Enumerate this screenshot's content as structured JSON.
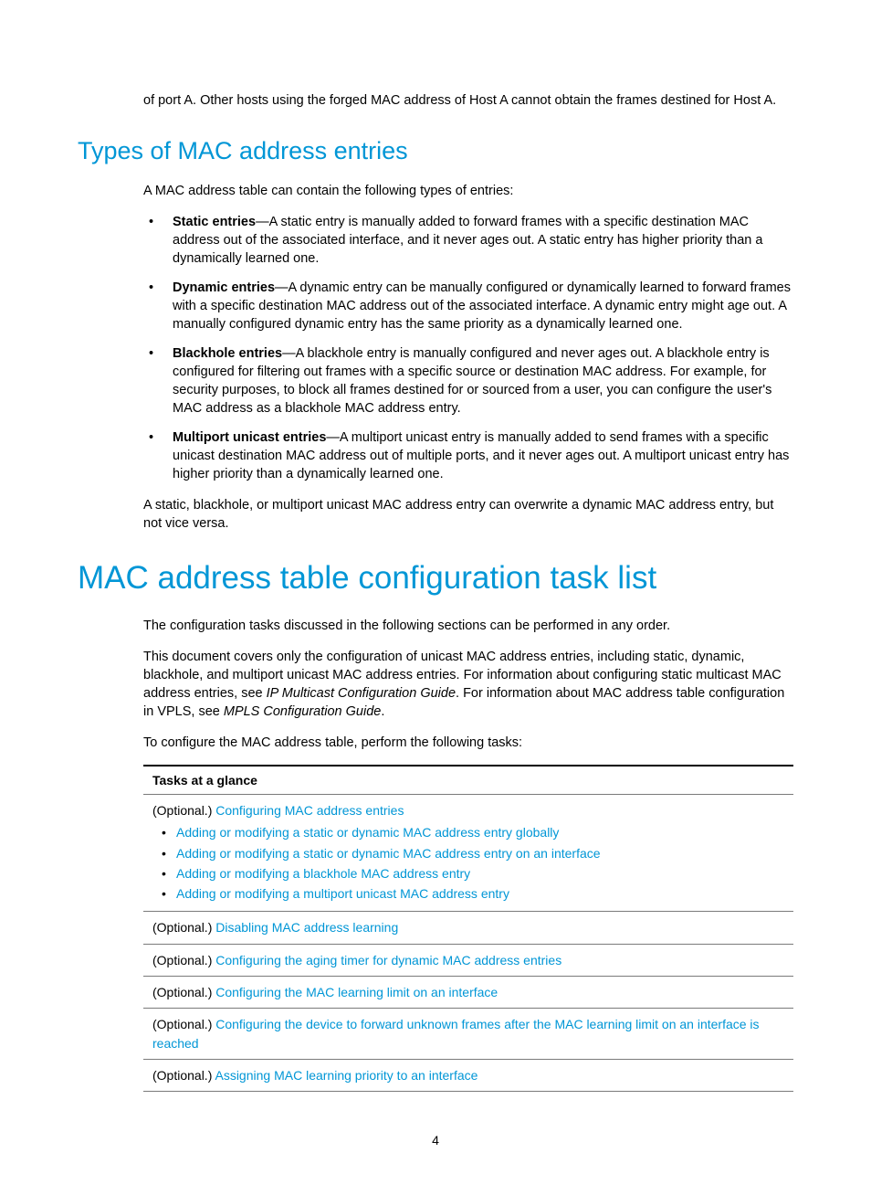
{
  "intro_continuation": "of port A. Other hosts using the forged MAC address of Host A cannot obtain the frames destined for Host A.",
  "section1": {
    "heading": "Types of MAC address entries",
    "lead": "A MAC address table can contain the following types of entries:",
    "entries": [
      {
        "term": "Static entries",
        "desc": "—A static entry is manually added to forward frames with a specific destination MAC address out of the associated interface, and it never ages out. A static entry has higher priority than a dynamically learned one."
      },
      {
        "term": "Dynamic entries",
        "desc": "—A dynamic entry can be manually configured or dynamically learned to forward frames with a specific destination MAC address out of the associated interface. A dynamic entry might age out. A manually configured dynamic entry has the same priority as a dynamically learned one."
      },
      {
        "term": "Blackhole entries",
        "desc": "—A blackhole entry is manually configured and never ages out. A blackhole entry is configured for filtering out frames with a specific source or destination MAC address. For example, for security purposes, to block all frames destined for or sourced from a user, you can configure the user's MAC address as a blackhole MAC address entry."
      },
      {
        "term": "Multiport unicast entries",
        "desc": "—A multiport unicast entry is manually added to send frames with a specific unicast destination MAC address out of multiple ports, and it never ages out. A multiport unicast entry has higher priority than a dynamically learned one."
      }
    ],
    "trailing": "A static, blackhole, or multiport unicast MAC address entry can overwrite a dynamic MAC address entry, but not vice versa."
  },
  "section2": {
    "heading": "MAC address table configuration task list",
    "p1": "The configuration tasks discussed in the following sections can be performed in any order.",
    "p2_pre": "This document covers only the configuration of unicast MAC address entries, including static, dynamic, blackhole, and multiport unicast MAC address entries. For information about configuring static multicast MAC address entries, see ",
    "p2_em1": "IP Multicast Configuration Guide",
    "p2_mid": ". For information about MAC address table configuration in VPLS, see ",
    "p2_em2": "MPLS Configuration Guide",
    "p2_post": ".",
    "p3": "To configure the MAC address table, perform the following tasks:",
    "table_header": "Tasks at a glance",
    "optional_label": "(Optional.) ",
    "row0_link": "Configuring MAC address entries",
    "row0_sub": [
      "Adding or modifying a static or dynamic MAC address entry globally",
      "Adding or modifying a static or dynamic MAC address entry on an interface",
      "Adding or modifying a blackhole MAC address entry",
      "Adding or modifying a multiport unicast MAC address entry"
    ],
    "row1_link": "Disabling MAC address learning",
    "row2_link": "Configuring the aging timer for dynamic MAC address entries",
    "row3_link": "Configuring the MAC learning limit on an interface",
    "row4_link": "Configuring the device to forward unknown frames after the MAC learning limit on an interface is reached",
    "row5_link": "Assigning MAC learning priority to an interface"
  },
  "page_number": "4"
}
